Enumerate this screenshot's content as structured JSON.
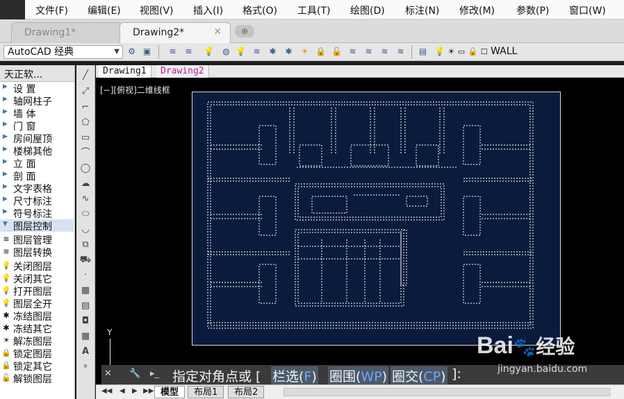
{
  "menu": [
    "文件(F)",
    "编辑(E)",
    "视图(V)",
    "插入(I)",
    "格式(O)",
    "工具(T)",
    "绘图(D)",
    "标注(N)",
    "修改(M)",
    "参数(P)",
    "窗口(W)"
  ],
  "tabs": [
    {
      "label": "Drawing1*",
      "active": false
    },
    {
      "label": "Drawing2*",
      "active": true
    }
  ],
  "toolbar": {
    "workspace": "AutoCAD 经典",
    "layer": "WALL"
  },
  "panel": {
    "title": "天正软...",
    "items": [
      {
        "label": "设    置",
        "kind": "group"
      },
      {
        "label": "轴网柱子",
        "kind": "group"
      },
      {
        "label": "墙    体",
        "kind": "group"
      },
      {
        "label": "门    窗",
        "kind": "group"
      },
      {
        "label": "房间屋顶",
        "kind": "group"
      },
      {
        "label": "楼梯其他",
        "kind": "group"
      },
      {
        "label": "立    面",
        "kind": "group"
      },
      {
        "label": "剖    面",
        "kind": "group"
      },
      {
        "label": "文字表格",
        "kind": "group"
      },
      {
        "label": "尺寸标注",
        "kind": "group"
      },
      {
        "label": "符号标注",
        "kind": "group"
      },
      {
        "label": "图层控制",
        "kind": "open"
      },
      {
        "label": "图层管理",
        "kind": "cmd"
      },
      {
        "label": "图层转换",
        "kind": "cmd"
      },
      {
        "label": "关闭图层",
        "kind": "cmd"
      },
      {
        "label": "关闭其它",
        "kind": "cmd"
      },
      {
        "label": "打开图层",
        "kind": "cmd"
      },
      {
        "label": "图层全开",
        "kind": "cmd"
      },
      {
        "label": "冻结图层",
        "kind": "cmd"
      },
      {
        "label": "冻结其它",
        "kind": "cmd"
      },
      {
        "label": "解冻图层",
        "kind": "cmd"
      },
      {
        "label": "锁定图层",
        "kind": "cmd"
      },
      {
        "label": "锁定其它",
        "kind": "cmd"
      },
      {
        "label": "解锁图层",
        "kind": "cmd"
      }
    ]
  },
  "filetabs": [
    "Drawing1",
    "Drawing2"
  ],
  "viewport": {
    "label": "[−][俯视]二维线框",
    "ucs_y": "Y"
  },
  "command": {
    "prompt": "指定对角点或 [",
    "options": [
      {
        "text": "栏选(",
        "key": "F",
        "end": ")"
      },
      {
        "text": "圈围(",
        "key": "WP",
        "end": ")"
      },
      {
        "text": "圈交(",
        "key": "CP",
        "end": ")"
      }
    ],
    "suffix": "]:"
  },
  "layouts": [
    "模型",
    "布局1",
    "布局2"
  ],
  "watermark": {
    "brand": "Bai",
    "brand2": "经验",
    "url": "jingyan.baidu.com"
  },
  "colors": {
    "paper": "#0a1b3d",
    "linework": "#dcdcdc",
    "cmd_key": "#6fa8ff",
    "tab_drawing2": "#c01a8c"
  }
}
